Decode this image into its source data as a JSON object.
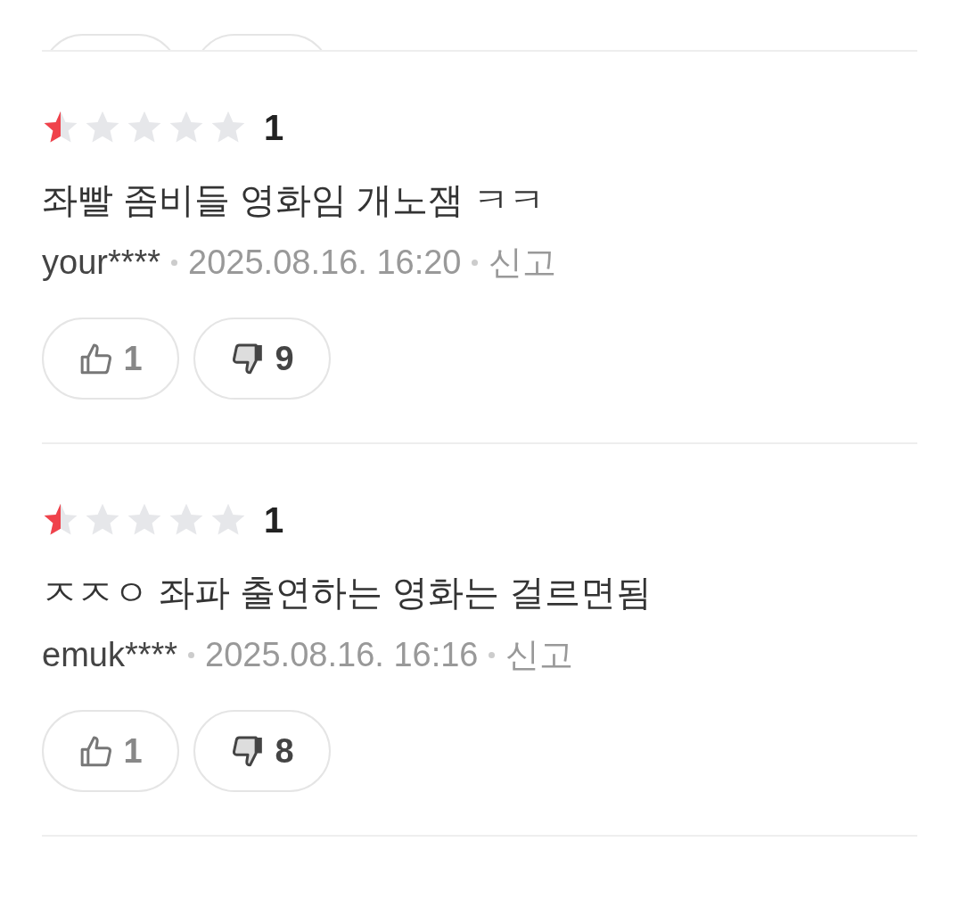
{
  "reviews": [
    {
      "stars": 0.5,
      "rating": "1",
      "text": "좌빨 좀비들 영화임 개노잼 ㅋㅋ",
      "author": "your****",
      "date": "2025.08.16. 16:20",
      "report": "신고",
      "likes": "1",
      "dislikes": "9"
    },
    {
      "stars": 0.5,
      "rating": "1",
      "text": "ㅈㅈㅇ 좌파 출연하는 영화는 걸르면됨",
      "author": "emuk****",
      "date": "2025.08.16. 16:16",
      "report": "신고",
      "likes": "1",
      "dislikes": "8"
    }
  ]
}
